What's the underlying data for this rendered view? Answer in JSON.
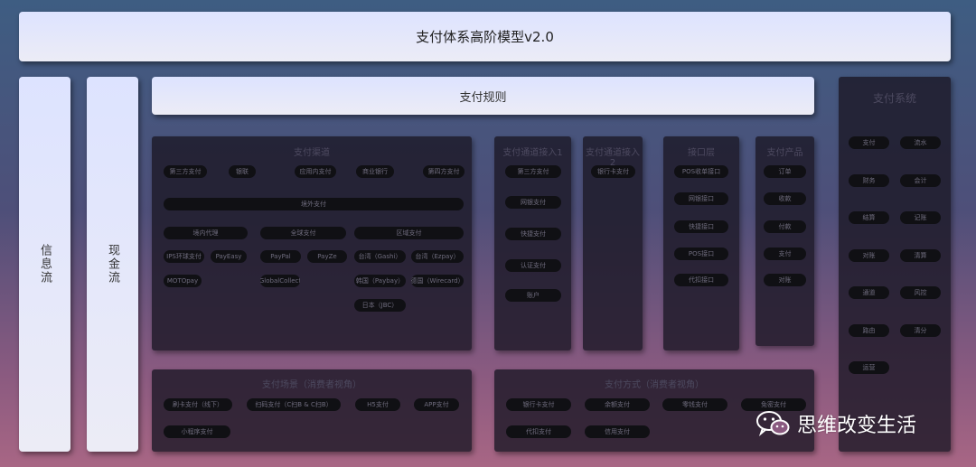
{
  "title": "支付体系高阶模型v2.0",
  "rules": "支付规则",
  "info_flow": "信息流",
  "cash_flow": "现金流",
  "watermark": "思维改变生活",
  "channels_panel": {
    "title": "支付渠道",
    "row1": [
      "第三方支付",
      "银联",
      "应用内支付",
      "商业银行",
      "第四方支付"
    ],
    "wide": "境外支付",
    "groups": [
      "境内代理",
      "全球支付",
      "区域支付"
    ],
    "items": [
      "IPS环球支付",
      "PayEasy",
      "PayPal",
      "PayZe",
      "台湾（Gashi）",
      "台湾（Ezpay）",
      "MOTOpay",
      "GlobalCollect",
      "韩国（Paybay）",
      "德国（Wirecard）",
      "日本（JBC）"
    ]
  },
  "access1": {
    "title": "支付通道接入1",
    "items": [
      "第三方支付",
      "网银支付",
      "快捷支付",
      "认证支付",
      "账户"
    ]
  },
  "access2": {
    "title": "支付通道接入2",
    "items": [
      "银行卡支付"
    ]
  },
  "interfaces": {
    "title": "接口层",
    "items": [
      "POS收单接口",
      "网银接口",
      "快捷接口",
      "POS接口",
      "代扣接口"
    ]
  },
  "products": {
    "title": "支付产品",
    "items": [
      "订单",
      "收款",
      "付款",
      "支付",
      "对账"
    ]
  },
  "system": {
    "title": "支付系统",
    "items": [
      "支付",
      "流水",
      "财务",
      "会计",
      "结算",
      "记账",
      "对账",
      "清算",
      "通道",
      "风控",
      "路由",
      "清分",
      "运营"
    ]
  },
  "scenes": {
    "title": "支付场景（消费者视角）",
    "items": [
      "刷卡支付（线下）",
      "扫码支付（C扫B & C扫B）",
      "H5支付",
      "APP支付",
      "小程序支付"
    ]
  },
  "methods": {
    "title": "支付方式（消费者视角）",
    "items": [
      "银行卡支付",
      "余额支付",
      "零钱支付",
      "免密支付",
      "代扣支付",
      "信用支付"
    ]
  }
}
